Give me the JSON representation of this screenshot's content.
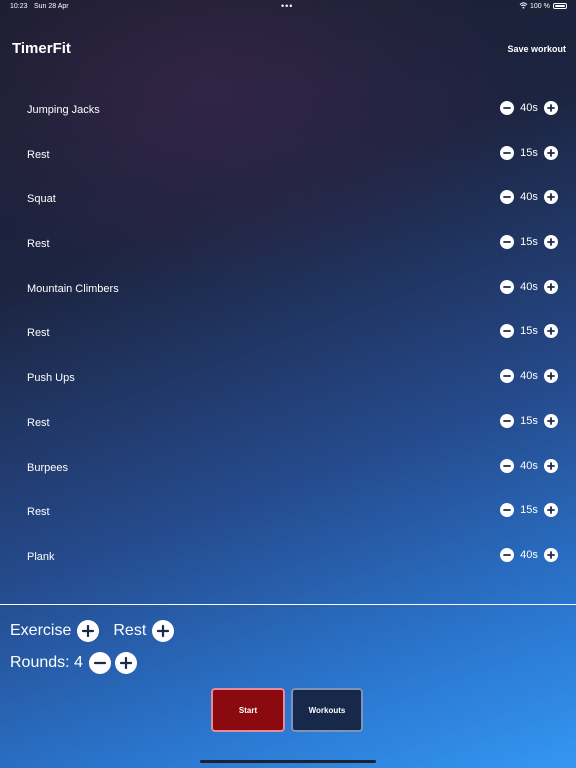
{
  "status_bar": {
    "time": "10:23",
    "date": "Sun 28 Apr",
    "battery_text": "100 %",
    "battery_level": 1.0
  },
  "header": {
    "title": "TimerFit",
    "save_label": "Save workout"
  },
  "items": [
    {
      "name": "Jumping Jacks",
      "duration": "40s"
    },
    {
      "name": "Rest",
      "duration": "15s"
    },
    {
      "name": "Squat",
      "duration": "40s"
    },
    {
      "name": "Rest",
      "duration": "15s"
    },
    {
      "name": "Mountain Climbers",
      "duration": "40s"
    },
    {
      "name": "Rest",
      "duration": "15s"
    },
    {
      "name": "Push Ups",
      "duration": "40s"
    },
    {
      "name": "Rest",
      "duration": "15s"
    },
    {
      "name": "Burpees",
      "duration": "40s"
    },
    {
      "name": "Rest",
      "duration": "15s"
    },
    {
      "name": "Plank",
      "duration": "40s"
    }
  ],
  "bottom": {
    "exercise_label": "Exercise",
    "rest_label": "Rest",
    "rounds_label": "Rounds: 4",
    "start_label": "Start",
    "workouts_label": "Workouts"
  },
  "icons": {
    "add": "plus-circle-icon",
    "remove": "minus-circle-icon",
    "wifi": "wifi-icon",
    "battery": "battery-icon"
  },
  "colors": {
    "start_button": "#8b0a10",
    "workouts_button": "#18284a",
    "text": "#ffffff"
  }
}
